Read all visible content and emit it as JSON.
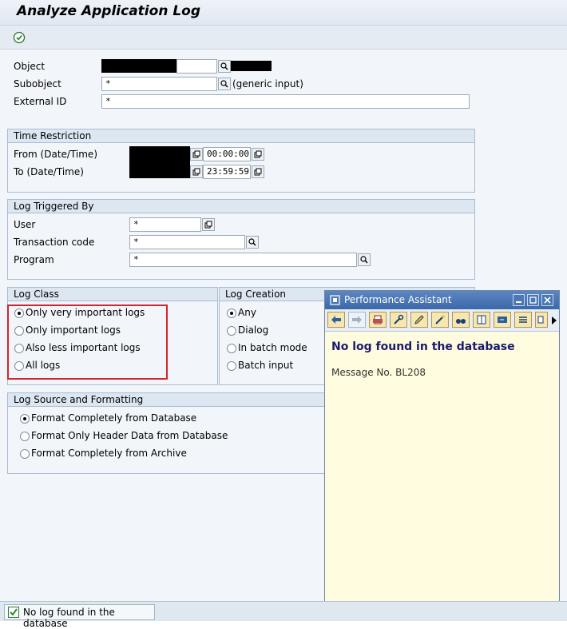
{
  "window": {
    "title": "Analyze Application Log"
  },
  "toolbar": {
    "execute_icon": "execute-icon"
  },
  "selection": {
    "object_label": "Object",
    "subobject_label": "Subobject",
    "subobject_value": "*",
    "subobject_hint": "(generic input)",
    "external_id_label": "External ID",
    "external_id_value": "*"
  },
  "time_restriction": {
    "title": "Time Restriction",
    "from_label": "From (Date/Time)",
    "from_time": "00:00:00",
    "to_label": "To (Date/Time)",
    "to_time": "23:59:59"
  },
  "log_triggered_by": {
    "title": "Log Triggered By",
    "user_label": "User",
    "user_value": "*",
    "tcode_label": "Transaction code",
    "tcode_value": "*",
    "program_label": "Program",
    "program_value": "*"
  },
  "log_class": {
    "title": "Log Class",
    "options": [
      {
        "label": "Only very important logs",
        "selected": true
      },
      {
        "label": "Only important logs",
        "selected": false
      },
      {
        "label": "Also less important logs",
        "selected": false
      },
      {
        "label": "All logs",
        "selected": false
      }
    ]
  },
  "log_creation": {
    "title": "Log Creation",
    "options": [
      {
        "label": "Any",
        "selected": true
      },
      {
        "label": "Dialog",
        "selected": false
      },
      {
        "label": "In batch mode",
        "selected": false
      },
      {
        "label": "Batch input",
        "selected": false
      }
    ]
  },
  "log_source": {
    "title": "Log Source and Formatting",
    "options": [
      {
        "label": "Format Completely from Database",
        "selected": true
      },
      {
        "label": "Format Only Header Data from Database",
        "selected": false
      },
      {
        "label": "Format Completely from Archive",
        "selected": false
      }
    ]
  },
  "performance_assistant": {
    "title": "Performance Assistant",
    "heading": "No log found in the database",
    "message": "Message No. BL208"
  },
  "status_bar": {
    "message": "No log found in the database",
    "icon": "success-check-icon"
  },
  "colors": {
    "highlight": "#d3262b",
    "heading_text": "#1a1a6e",
    "title_bar": "#3b68a8"
  }
}
